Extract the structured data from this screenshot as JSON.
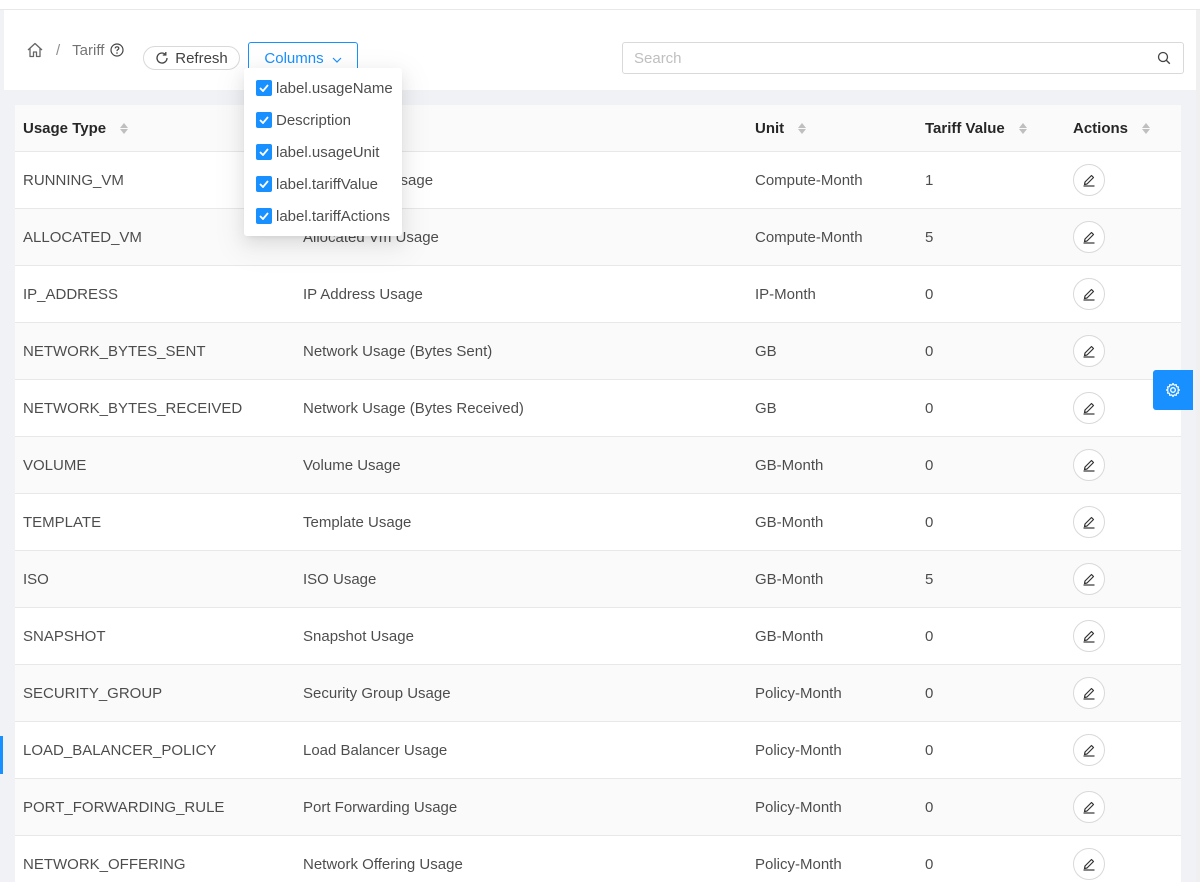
{
  "breadcrumb": {
    "home_icon": "home-icon",
    "separator": "/",
    "current": "Tariff",
    "help_icon": "question-circle-icon"
  },
  "toolbar": {
    "refresh_label": "Refresh",
    "columns_label": "Columns",
    "search_placeholder": "Search"
  },
  "columns_menu": {
    "items": [
      {
        "label": "label.usageName",
        "checked": true
      },
      {
        "label": "Description",
        "checked": true
      },
      {
        "label": "label.usageUnit",
        "checked": true
      },
      {
        "label": "label.tariffValue",
        "checked": true
      },
      {
        "label": "label.tariffActions",
        "checked": true
      }
    ]
  },
  "table": {
    "headers": {
      "type": "Usage Type",
      "unit": "Unit",
      "value": "Tariff Value",
      "actions": "Actions"
    },
    "rows": [
      {
        "type": "RUNNING_VM",
        "description": "Running Vm Usage",
        "unit": "Compute-Month",
        "value": "1"
      },
      {
        "type": "ALLOCATED_VM",
        "description": "Allocated Vm Usage",
        "unit": "Compute-Month",
        "value": "5"
      },
      {
        "type": "IP_ADDRESS",
        "description": "IP Address Usage",
        "unit": "IP-Month",
        "value": "0"
      },
      {
        "type": "NETWORK_BYTES_SENT",
        "description": "Network Usage (Bytes Sent)",
        "unit": "GB",
        "value": "0"
      },
      {
        "type": "NETWORK_BYTES_RECEIVED",
        "description": "Network Usage (Bytes Received)",
        "unit": "GB",
        "value": "0"
      },
      {
        "type": "VOLUME",
        "description": "Volume Usage",
        "unit": "GB-Month",
        "value": "0"
      },
      {
        "type": "TEMPLATE",
        "description": "Template Usage",
        "unit": "GB-Month",
        "value": "0"
      },
      {
        "type": "ISO",
        "description": "ISO Usage",
        "unit": "GB-Month",
        "value": "5"
      },
      {
        "type": "SNAPSHOT",
        "description": "Snapshot Usage",
        "unit": "GB-Month",
        "value": "0"
      },
      {
        "type": "SECURITY_GROUP",
        "description": "Security Group Usage",
        "unit": "Policy-Month",
        "value": "0"
      },
      {
        "type": "LOAD_BALANCER_POLICY",
        "description": "Load Balancer Usage",
        "unit": "Policy-Month",
        "value": "0"
      },
      {
        "type": "PORT_FORWARDING_RULE",
        "description": "Port Forwarding Usage",
        "unit": "Policy-Month",
        "value": "0"
      },
      {
        "type": "NETWORK_OFFERING",
        "description": "Network Offering Usage",
        "unit": "Policy-Month",
        "value": "0"
      }
    ]
  },
  "colors": {
    "accent": "#1890ff",
    "border": "#e8e8e8",
    "row_alt": "#fafafa"
  }
}
